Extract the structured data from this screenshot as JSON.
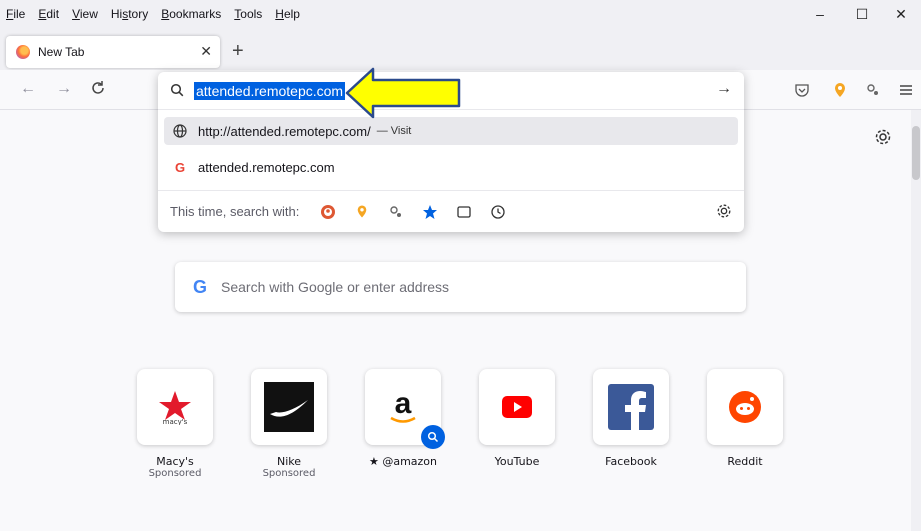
{
  "menu": [
    "File",
    "Edit",
    "View",
    "History",
    "Bookmarks",
    "Tools",
    "Help"
  ],
  "menu_underline": [
    "F",
    "E",
    "V",
    "s",
    "B",
    "T",
    "H"
  ],
  "window_controls": {
    "minimize": "–",
    "maximize": "☐",
    "close": "✕"
  },
  "tab": {
    "title": "New Tab",
    "close": "✕",
    "new": "+"
  },
  "nav": {
    "back": "←",
    "forward": "→",
    "reload": "C"
  },
  "urlbar": {
    "value": "attended.remotepc.com",
    "go": "→"
  },
  "suggestions": [
    {
      "text": "http://attended.remotepc.com/",
      "action": "— Visit",
      "icon": "globe-icon"
    },
    {
      "text": "attended.remotepc.com",
      "icon": "google-icon"
    }
  ],
  "oneoff": {
    "label": "This time, search with:",
    "engines": [
      "duckduckgo-icon",
      "location-pin-icon",
      "extension-icon",
      "bookmarks-star-icon",
      "tabs-icon",
      "history-clock-icon"
    ]
  },
  "search": {
    "placeholder": "Search with Google or enter address",
    "google_letter": "G"
  },
  "top_sites": [
    {
      "name": "Macy's",
      "sponsored": "Sponsored"
    },
    {
      "name": "Nike",
      "sponsored": "Sponsored"
    },
    {
      "name": "@amazon",
      "sponsored": ""
    },
    {
      "name": "YouTube",
      "sponsored": ""
    },
    {
      "name": "Facebook",
      "sponsored": ""
    },
    {
      "name": "Reddit",
      "sponsored": ""
    }
  ],
  "colors": {
    "accent": "#0061e0",
    "arrow_fill": "#ffff00",
    "arrow_stroke": "#2b4a8c"
  }
}
